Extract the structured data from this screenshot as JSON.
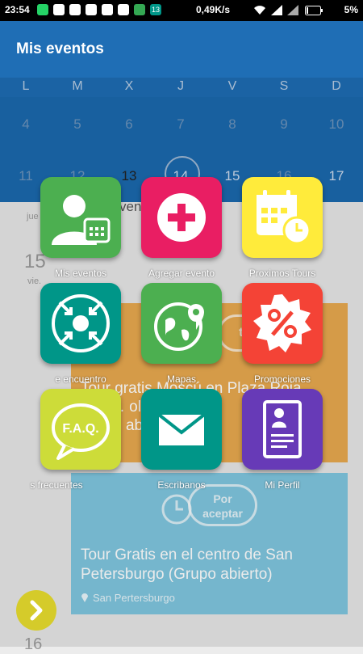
{
  "status_bar": {
    "time": "23:54",
    "speed": "0,49K/s",
    "battery": "5%",
    "notif_badge": "13"
  },
  "app_bar": {
    "title": "Mis eventos"
  },
  "calendar": {
    "weekdays": [
      "L",
      "M",
      "X",
      "J",
      "V",
      "S",
      "D"
    ],
    "row1": [
      "4",
      "5",
      "6",
      "7",
      "8",
      "9",
      "10"
    ],
    "row2": [
      "11",
      "12",
      "13",
      "14",
      "15",
      "16",
      "17"
    ]
  },
  "background": {
    "day_15": "15",
    "day_15_label": "vie.",
    "day_13_label": "jue",
    "day_16": "16",
    "events_partial": "ven",
    "card1_badge": "tado",
    "card1_title_l1": "Tour gratis Moscú en Plaza Roja",
    "card1_title_l2": "(in s… ol d…",
    "card1_title_l3": "nto … abierto)",
    "card2_badge_l1": "Por",
    "card2_badge_l2": "aceptar",
    "card2_title_l1": "Tour Gratis en el centro de San",
    "card2_title_l2": "Petersburgo (Grupo abierto)",
    "card2_location": "San Pertersburgo"
  },
  "menu": {
    "items": [
      {
        "label": "Mis eventos",
        "color": "#4caf50"
      },
      {
        "label": "Agregar evento",
        "color": "#e91e63"
      },
      {
        "label": "Proximos Tours",
        "color": "#ffeb3b"
      },
      {
        "label": "e encuentro",
        "color": "#009688"
      },
      {
        "label": "Mapas",
        "color": "#4caf50"
      },
      {
        "label": "Promociones",
        "color": "#f44336"
      },
      {
        "label": "s frecuentes",
        "color": "#cddc39"
      },
      {
        "label": "Escribanos",
        "color": "#009688"
      },
      {
        "label": "Mi Perfil",
        "color": "#673ab7"
      }
    ],
    "faq_text": "F.A.Q."
  },
  "icons": [
    "user-calendar-icon",
    "plus-icon",
    "calendar-clock-icon",
    "meeting-point-icon",
    "map-pin-icon",
    "percent-badge-icon",
    "faq-bubble-icon",
    "envelope-icon",
    "profile-document-icon",
    "chevron-right-icon"
  ]
}
